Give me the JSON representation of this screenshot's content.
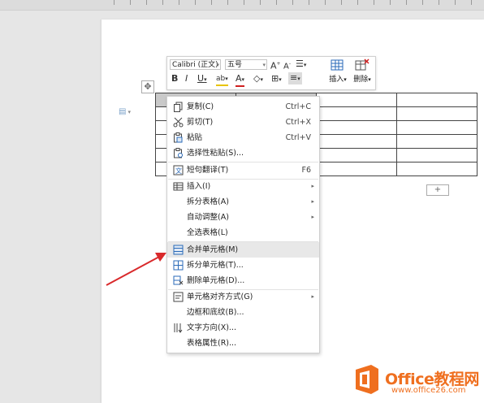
{
  "toolbar": {
    "font_name": "Calibri (正文)",
    "font_size": "五号",
    "insert_label": "插入",
    "delete_label": "删除"
  },
  "context_menu": {
    "items": [
      {
        "label": "复制(C)",
        "shortcut": "Ctrl+C",
        "icon": "copy-icon"
      },
      {
        "label": "剪切(T)",
        "shortcut": "Ctrl+X",
        "icon": "cut-icon"
      },
      {
        "label": "粘贴",
        "shortcut": "Ctrl+V",
        "icon": "paste-icon"
      },
      {
        "label": "选择性粘贴(S)...",
        "icon": "paste-special-icon"
      },
      {
        "label": "短句翻译(T)",
        "shortcut": "F6",
        "icon": "translate-icon"
      },
      {
        "label": "插入(I)",
        "submenu": true,
        "icon": "insert-table-icon"
      },
      {
        "label": "拆分表格(A)",
        "submenu": true
      },
      {
        "label": "自动调整(A)",
        "submenu": true
      },
      {
        "label": "全选表格(L)"
      },
      {
        "label": "合并单元格(M)",
        "icon": "merge-cells-icon",
        "highlighted": true
      },
      {
        "label": "拆分单元格(T)...",
        "icon": "split-cells-icon"
      },
      {
        "label": "删除单元格(D)...",
        "icon": "delete-cells-icon"
      },
      {
        "label": "单元格对齐方式(G)",
        "submenu": true,
        "icon": "cell-align-icon"
      },
      {
        "label": "边框和底纹(B)..."
      },
      {
        "label": "文字方向(X)...",
        "icon": "text-direction-icon"
      },
      {
        "label": "表格属性(R)..."
      }
    ]
  },
  "watermark": {
    "brand": "Office教程网",
    "url": "www.office26.com",
    "color": "#ef6f1f"
  },
  "colors": {
    "arrow": "#d9292b",
    "selected_cell": "#c9c9c9",
    "menu_highlight": "#e8e8e8"
  }
}
